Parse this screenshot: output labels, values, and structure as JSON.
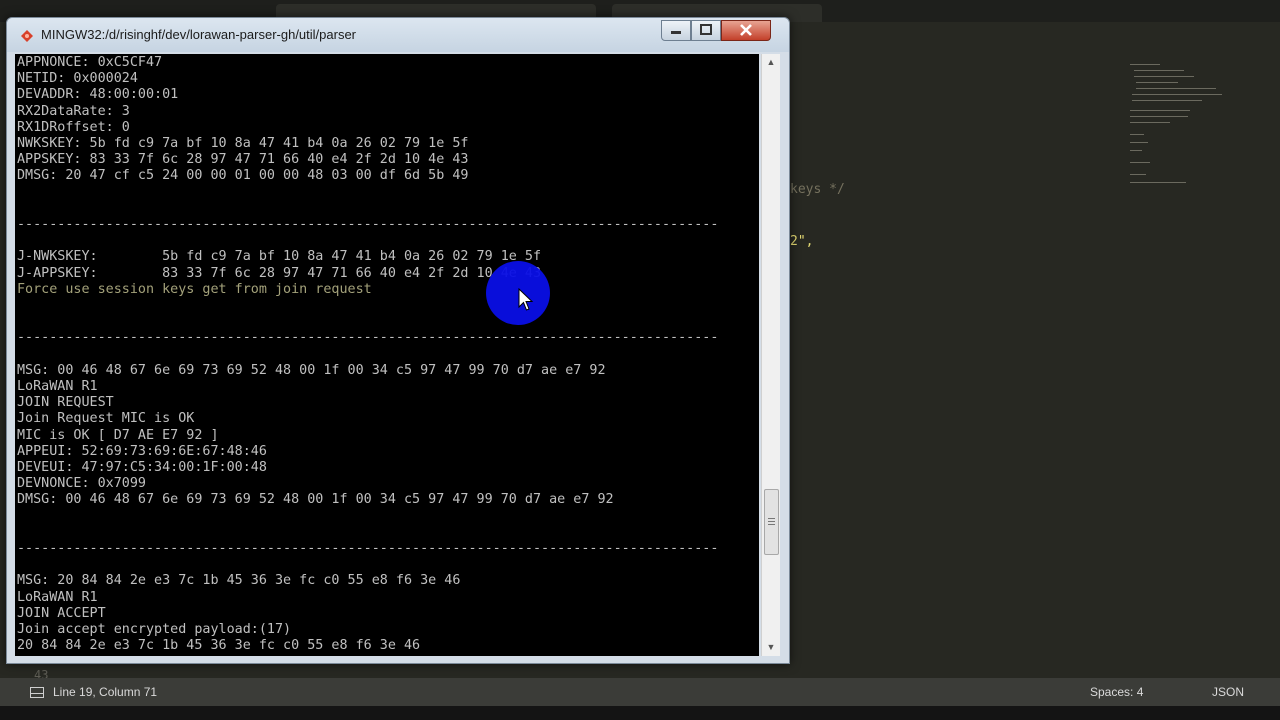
{
  "window": {
    "title": "MINGW32:/d/risinghf/dev/lorawan-parser-gh/util/parser",
    "controls": {
      "minimize": "minimize",
      "maximize": "maximize",
      "close": "close"
    }
  },
  "console": {
    "lines": [
      {
        "text": "APPNONCE: 0xC5CF47",
        "style": "normal"
      },
      {
        "text": "NETID: 0x000024",
        "style": "normal"
      },
      {
        "text": "DEVADDR: 48:00:00:01",
        "style": "normal"
      },
      {
        "text": "RX2DataRate: 3",
        "style": "normal"
      },
      {
        "text": "RX1DRoffset: 0",
        "style": "normal"
      },
      {
        "text": "NWKSKEY: 5b fd c9 7a bf 10 8a 47 41 b4 0a 26 02 79 1e 5f",
        "style": "normal"
      },
      {
        "text": "APPSKEY: 83 33 7f 6c 28 97 47 71 66 40 e4 2f 2d 10 4e 43",
        "style": "normal"
      },
      {
        "text": "DMSG: 20 47 cf c5 24 00 00 01 00 00 48 03 00 df 6d 5b 49",
        "style": "normal"
      },
      {
        "text": "",
        "style": "normal"
      },
      {
        "text": "",
        "style": "normal"
      },
      {
        "text": "---------------------------------------------------------------------------------------",
        "style": "sep"
      },
      {
        "text": "",
        "style": "normal"
      },
      {
        "text": "J-NWKSKEY:        5b fd c9 7a bf 10 8a 47 41 b4 0a 26 02 79 1e 5f",
        "style": "normal"
      },
      {
        "text": "J-APPSKEY:        83 33 7f 6c 28 97 47 71 66 40 e4 2f 2d 10 4e 43",
        "style": "normal"
      },
      {
        "text": "Force use session keys get from join request",
        "style": "yellow"
      },
      {
        "text": "",
        "style": "normal"
      },
      {
        "text": "",
        "style": "normal"
      },
      {
        "text": "---------------------------------------------------------------------------------------",
        "style": "sep"
      },
      {
        "text": "",
        "style": "normal"
      },
      {
        "text": "MSG: 00 46 48 67 6e 69 73 69 52 48 00 1f 00 34 c5 97 47 99 70 d7 ae e7 92",
        "style": "normal"
      },
      {
        "text": "LoRaWAN R1",
        "style": "normal"
      },
      {
        "text": "JOIN REQUEST",
        "style": "normal"
      },
      {
        "text": "Join Request MIC is OK",
        "style": "normal"
      },
      {
        "text": "MIC is OK [ D7 AE E7 92 ]",
        "style": "normal"
      },
      {
        "text": "APPEUI: 52:69:73:69:6E:67:48:46",
        "style": "normal"
      },
      {
        "text": "DEVEUI: 47:97:C5:34:00:1F:00:48",
        "style": "normal"
      },
      {
        "text": "DEVNONCE: 0x7099",
        "style": "normal"
      },
      {
        "text": "DMSG: 00 46 48 67 6e 69 73 69 52 48 00 1f 00 34 c5 97 47 99 70 d7 ae e7 92",
        "style": "normal"
      },
      {
        "text": "",
        "style": "normal"
      },
      {
        "text": "",
        "style": "normal"
      },
      {
        "text": "---------------------------------------------------------------------------------------",
        "style": "sep"
      },
      {
        "text": "",
        "style": "normal"
      },
      {
        "text": "MSG: 20 84 84 2e e3 7c 1b 45 36 3e fc c0 55 e8 f6 3e 46",
        "style": "normal"
      },
      {
        "text": "LoRaWAN R1",
        "style": "normal"
      },
      {
        "text": "JOIN ACCEPT",
        "style": "normal"
      },
      {
        "text": "Join accept encrypted payload:(17)",
        "style": "normal"
      },
      {
        "text": "20 84 84 2e e3 7c 1b 45 36 3e fc c0 55 e8 f6 3e 46",
        "style": "normal"
      }
    ]
  },
  "editor_background": {
    "fragments": [
      {
        "text": "keys */",
        "style": "comment"
      },
      {
        "text": "2\",",
        "style": "str"
      }
    ],
    "gutter_line": "43"
  },
  "statusbar": {
    "position": "Line 19, Column 71",
    "indent": "Spaces: 4",
    "syntax": "JSON"
  },
  "colors": {
    "console_bg": "#000000",
    "console_text": "#c0c0c0",
    "console_highlight": "#a3a17a",
    "editor_bg": "#272822",
    "click_marker": "#0a0fe6"
  }
}
